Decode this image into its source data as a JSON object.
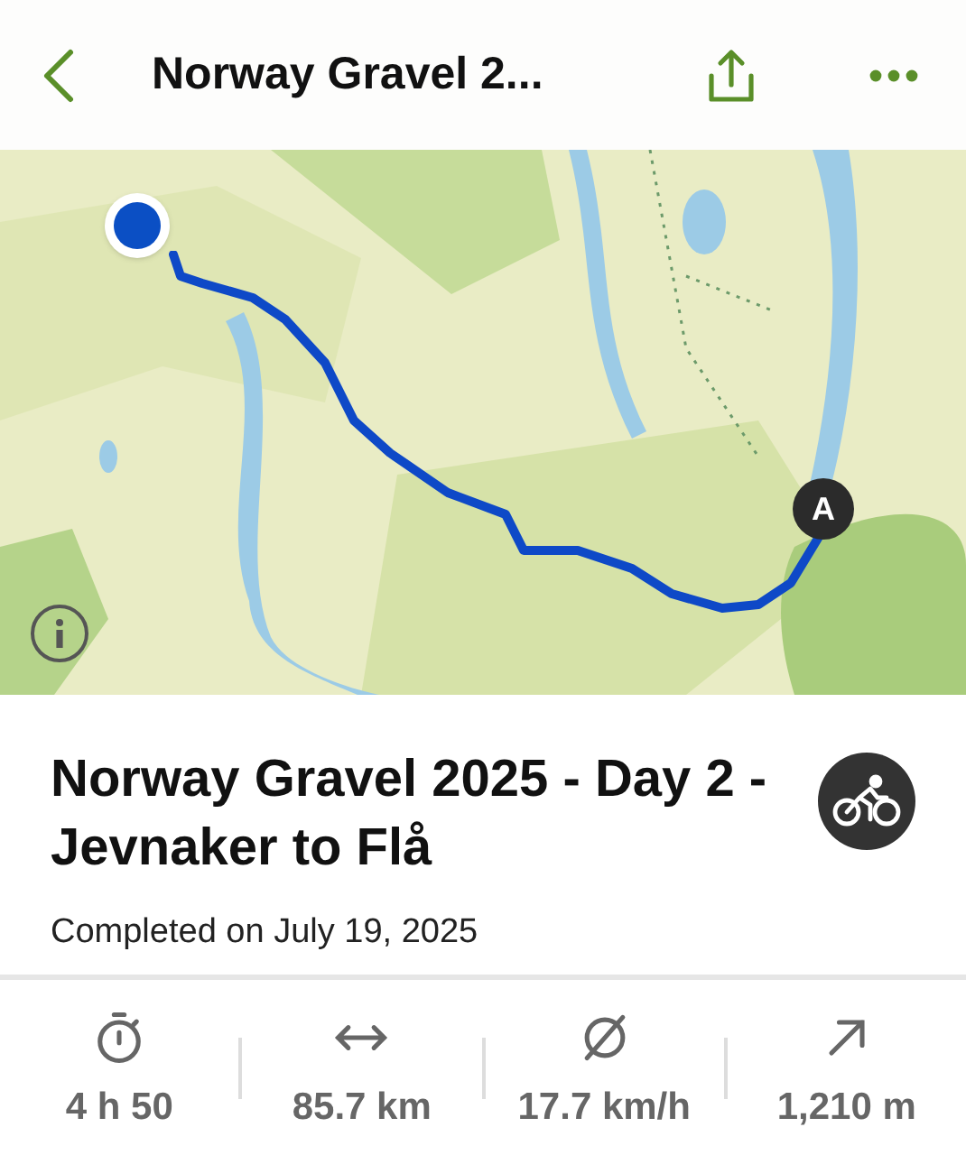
{
  "header": {
    "title": "Norway Gravel 2..."
  },
  "map": {
    "kind": "picture",
    "end_marker": "A"
  },
  "activity": {
    "title": "Norway Gravel 2025 - Day 2 - Jevnaker to Flå",
    "subtitle": "Completed on July 19, 2025"
  },
  "stats": [
    {
      "kind": "duration",
      "value": "4 h 50"
    },
    {
      "kind": "distance",
      "value": "85.7 km"
    },
    {
      "kind": "speed",
      "value": "17.7 km/h"
    },
    {
      "kind": "elevation",
      "value": "1,210 m"
    }
  ]
}
